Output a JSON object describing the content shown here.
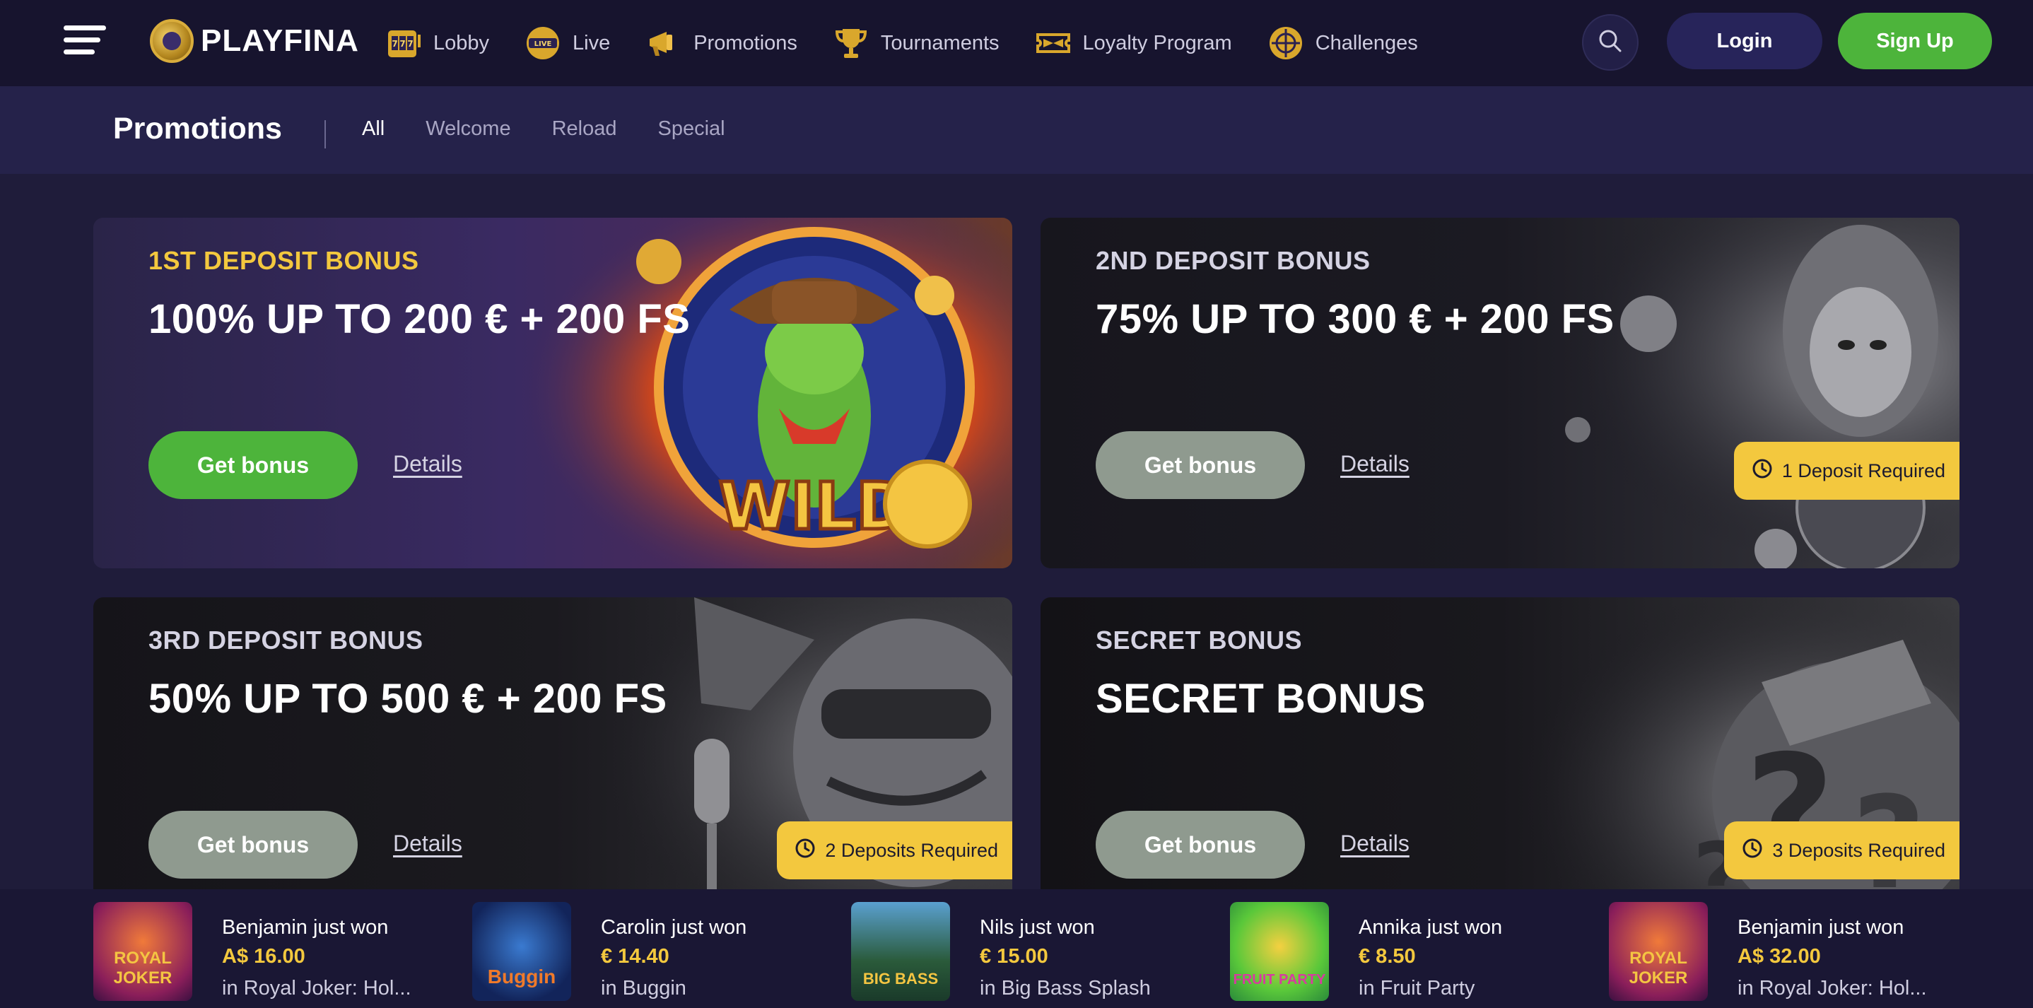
{
  "brand": {
    "name": "PLAYFINA"
  },
  "nav": {
    "items": [
      {
        "label": "Lobby",
        "icon": "slot-machine-icon"
      },
      {
        "label": "Live",
        "icon": "live-badge-icon"
      },
      {
        "label": "Promotions",
        "icon": "megaphone-icon"
      },
      {
        "label": "Tournaments",
        "icon": "trophy-icon"
      },
      {
        "label": "Loyalty Program",
        "icon": "ticket-icon"
      },
      {
        "label": "Challenges",
        "icon": "target-icon"
      }
    ],
    "login_label": "Login",
    "signup_label": "Sign Up"
  },
  "subheader": {
    "title": "Promotions",
    "filters": [
      "All",
      "Welcome",
      "Reload",
      "Special"
    ],
    "active_filter": "All"
  },
  "promos": [
    {
      "kicker": "1ST DEPOSIT BONUS",
      "headline": "100% UP TO 200 € + 200 FS",
      "cta": "Get bonus",
      "details": "Details",
      "requirement": ""
    },
    {
      "kicker": "2ND DEPOSIT BONUS",
      "headline": "75% UP TO 300 € + 200 FS",
      "cta": "Get bonus",
      "details": "Details",
      "requirement": "1 Deposit Required"
    },
    {
      "kicker": "3RD DEPOSIT BONUS",
      "headline": "50% UP TO 500 € + 200 FS",
      "cta": "Get bonus",
      "details": "Details",
      "requirement": "2 Deposits Required"
    },
    {
      "kicker": "SECRET BONUS",
      "headline": "SECRET BONUS",
      "cta": "Get bonus",
      "details": "Details",
      "requirement": "3 Deposits Required"
    }
  ],
  "wins": [
    {
      "who": "Benjamin just won",
      "amount": "A$ 16.00",
      "game": "in Royal Joker: Hol...",
      "thumb_text": "ROYAL JOKER"
    },
    {
      "who": "Carolin just won",
      "amount": "€ 14.40",
      "game": "in Buggin",
      "thumb_text": "Buggin"
    },
    {
      "who": "Nils just won",
      "amount": "€ 15.00",
      "game": "in Big Bass Splash",
      "thumb_text": "BIG BASS"
    },
    {
      "who": "Annika just won",
      "amount": "€ 8.50",
      "game": "in Fruit Party",
      "thumb_text": "FRUIT PARTY"
    },
    {
      "who": "Benjamin just won",
      "amount": "A$ 32.00",
      "game": "in Royal Joker: Hol...",
      "thumb_text": "ROYAL JOKER"
    }
  ],
  "colors": {
    "accent_green": "#4db43b",
    "gold": "#f3c83e",
    "muted_button": "#8f9a8f",
    "nav_bg": "#17142e",
    "page_bg": "#1f1c3a"
  }
}
